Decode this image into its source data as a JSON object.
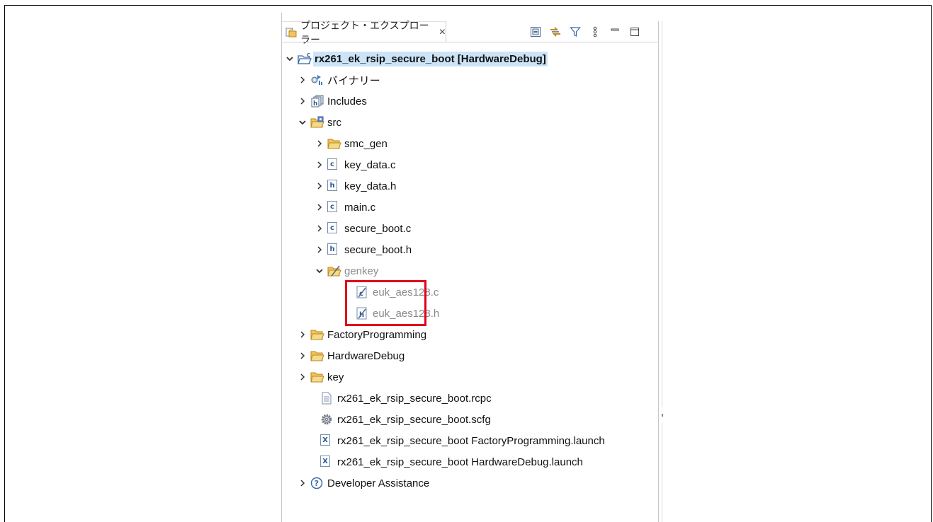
{
  "view": {
    "tab_title": "プロジェクト・エクスプローラー",
    "tab_close": "×"
  },
  "tree": {
    "project": "rx261_ek_rsip_secure_boot [HardwareDebug]",
    "binaries": "バイナリー",
    "includes": "Includes",
    "src": "src",
    "smc_gen": "smc_gen",
    "key_data_c": "key_data.c",
    "key_data_h": "key_data.h",
    "main_c": "main.c",
    "secure_boot_c": "secure_boot.c",
    "secure_boot_h": "secure_boot.h",
    "genkey": "genkey",
    "euk_aes128_c": "euk_aes128.c",
    "euk_aes128_h": "euk_aes128.h",
    "factory_programming": "FactoryProgramming",
    "hardware_debug": "HardwareDebug",
    "key": "key",
    "rcpc": "rx261_ek_rsip_secure_boot.rcpc",
    "scfg": "rx261_ek_rsip_secure_boot.scfg",
    "launch_factory": "rx261_ek_rsip_secure_boot FactoryProgramming.launch",
    "launch_hw": "rx261_ek_rsip_secure_boot HardwareDebug.launch",
    "dev_assist": "Developer Assistance"
  },
  "icons": {
    "c_file": "c",
    "h_file": "h",
    "launch_file": "X",
    "help": "?"
  },
  "colors": {
    "highlight": "#e3001b",
    "selection": "#cce4f7",
    "folder": "#f2c45a"
  }
}
